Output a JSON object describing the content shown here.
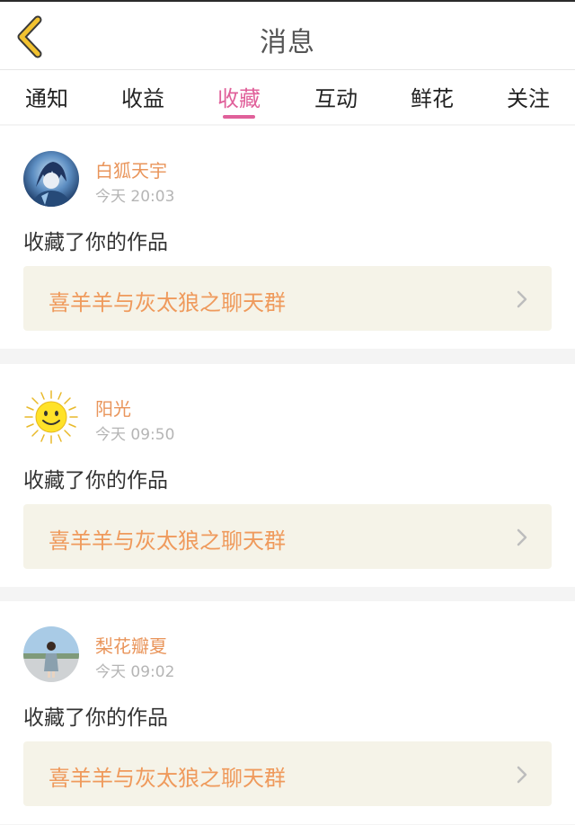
{
  "header": {
    "title": "消息"
  },
  "tabs": [
    {
      "label": "通知",
      "active": false
    },
    {
      "label": "收益",
      "active": false
    },
    {
      "label": "收藏",
      "active": true
    },
    {
      "label": "互动",
      "active": false
    },
    {
      "label": "鲜花",
      "active": false
    },
    {
      "label": "关注",
      "active": false
    }
  ],
  "colors": {
    "accent": "#e0609a",
    "username": "#e9955b",
    "work_title": "#ef9a5c",
    "work_box_bg": "#f5f3e8",
    "back_icon": "#f2c230"
  },
  "messages": [
    {
      "avatar_icon": "anime-character-avatar",
      "user": "白狐天宇",
      "time": "今天 20:03",
      "action": "收藏了你的作品",
      "work_title": "喜羊羊与灰太狼之聊天群"
    },
    {
      "avatar_icon": "sun-smiley-avatar",
      "user": "阳光",
      "time": "今天 09:50",
      "action": "收藏了你的作品",
      "work_title": "喜羊羊与灰太狼之聊天群"
    },
    {
      "avatar_icon": "girl-photo-avatar",
      "user": "梨花瓣夏",
      "time": "今天 09:02",
      "action": "收藏了你的作品",
      "work_title": "喜羊羊与灰太狼之聊天群"
    }
  ]
}
